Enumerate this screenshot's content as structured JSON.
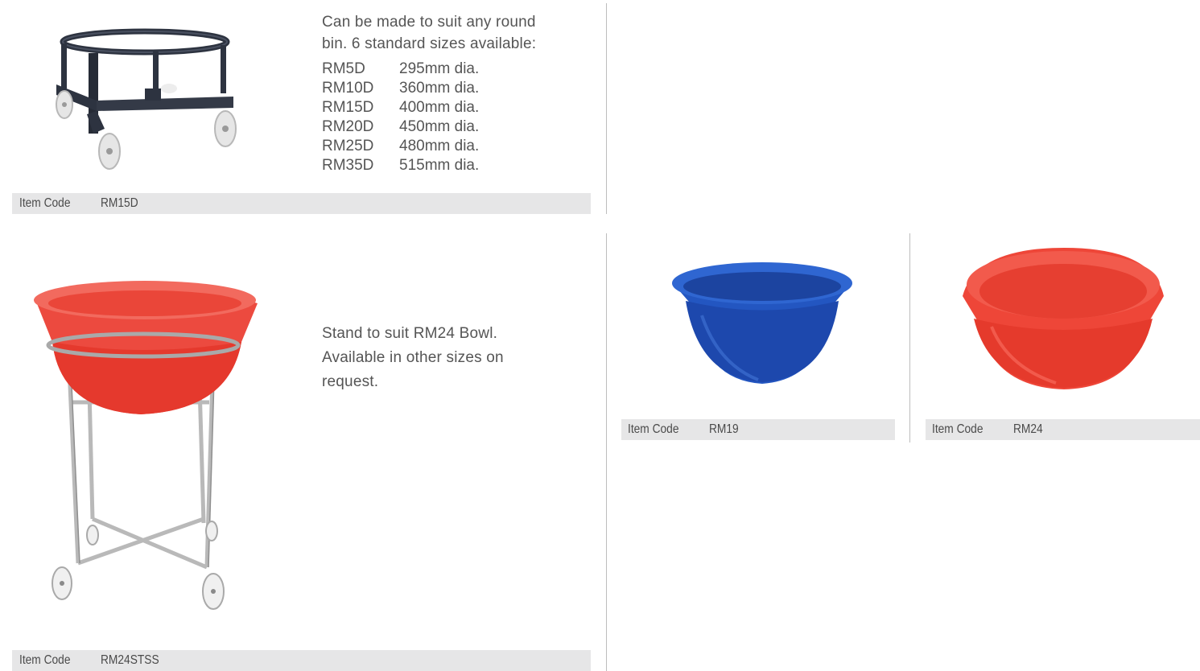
{
  "products": [
    {
      "id": "dolly",
      "item_code_label": "Item Code",
      "item_code": "RM15D",
      "description": [
        "Can be made to suit any round",
        "bin. 6 standard sizes available:"
      ],
      "sizes": [
        {
          "code": "RM5D",
          "dia": "295mm dia."
        },
        {
          "code": "RM10D",
          "dia": "360mm dia."
        },
        {
          "code": "RM15D",
          "dia": "400mm dia."
        },
        {
          "code": "RM20D",
          "dia": "450mm dia."
        },
        {
          "code": "RM25D",
          "dia": "480mm dia."
        },
        {
          "code": "RM35D",
          "dia": "515mm dia."
        }
      ]
    },
    {
      "id": "stand",
      "item_code_label": "Item Code",
      "item_code": "RM24STSS",
      "description": [
        "Stand to suit RM24 Bowl.",
        "Available in other sizes on",
        "request."
      ]
    },
    {
      "id": "blue-bowl",
      "item_code_label": "Item Code",
      "item_code": "RM19",
      "color": "#1f4fb0"
    },
    {
      "id": "red-bowl",
      "item_code_label": "Item Code",
      "item_code": "RM24",
      "color": "#ea3a2e"
    }
  ]
}
